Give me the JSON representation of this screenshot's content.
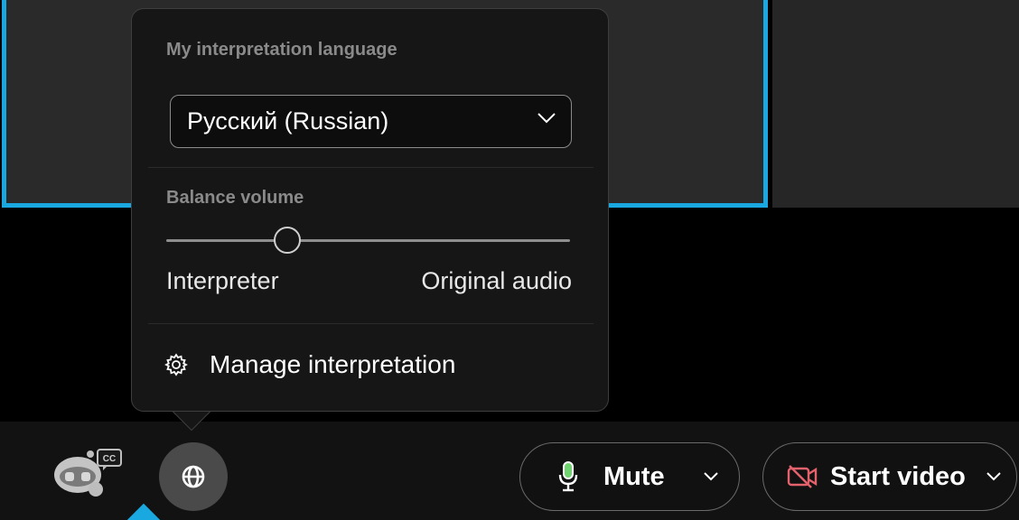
{
  "interpretation_popover": {
    "language_heading": "My interpretation language",
    "language_selected": "Русский (Russian)",
    "balance_heading": "Balance volume",
    "balance_value": 0.3,
    "balance_left_label": "Interpreter",
    "balance_right_label": "Original audio",
    "manage_label": "Manage interpretation",
    "manage_icon": "gear-icon"
  },
  "control_bar": {
    "assistant_icon": "ai-assistant-cc-icon",
    "assistant_badge": "CC",
    "interpretation_icon": "globe-icon",
    "mute": {
      "label": "Mute",
      "icon": "microphone-icon"
    },
    "video": {
      "label": "Start video",
      "icon": "video-off-icon"
    }
  },
  "colors": {
    "active_speaker_border": "#1aa8e0",
    "mic_green": "#6fd36f",
    "video_off_red": "#e3626c",
    "background": "#000000",
    "popover_bg": "#161616"
  }
}
